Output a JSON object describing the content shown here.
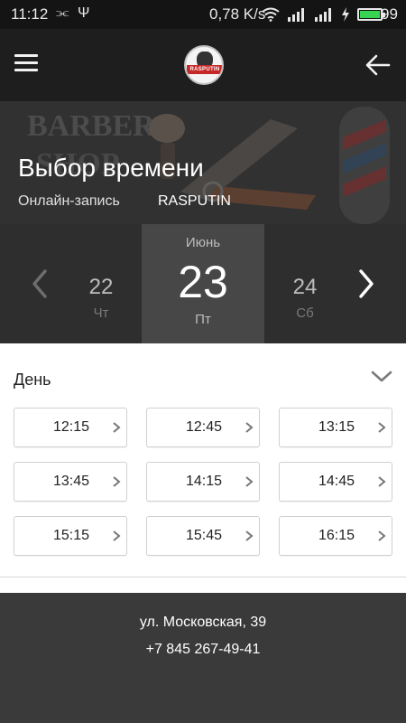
{
  "status_bar": {
    "time": "11:12",
    "net_speed": "0,78 K/s",
    "battery_level": "99",
    "battery_fill": 0.99,
    "icons": [
      "share-icon",
      "usb-icon",
      "wifi-icon",
      "signal-icon",
      "signal-icon",
      "charging-icon",
      "battery-icon"
    ]
  },
  "app_bar": {
    "logo_text": "RASPUTIN",
    "icons": [
      "menu-icon",
      "back-arrow-icon"
    ]
  },
  "hero": {
    "title": "Выбор времени",
    "subtitle": "Онлайн-запись",
    "organization": "RASPUTIN"
  },
  "date_picker": {
    "month": "Июнь",
    "prev": {
      "day": "22",
      "weekday": "Чт"
    },
    "selected": {
      "day": "23",
      "weekday": "Пт"
    },
    "next": {
      "day": "24",
      "weekday": "Сб"
    }
  },
  "slots_section": {
    "title": "День",
    "times": [
      "12:15",
      "12:45",
      "13:15",
      "13:45",
      "14:15",
      "14:45",
      "15:15",
      "15:45",
      "16:15"
    ]
  },
  "footer": {
    "address": "ул. Московская, 39",
    "phone": "+7 845 267-49-41"
  },
  "colors": {
    "status_bar": "#141414",
    "app_bar": "#1e1e1e",
    "date_bar": "#2e2e2e",
    "date_selected": "#474747",
    "footer": "#3a3a3a",
    "battery": "#39d353"
  }
}
